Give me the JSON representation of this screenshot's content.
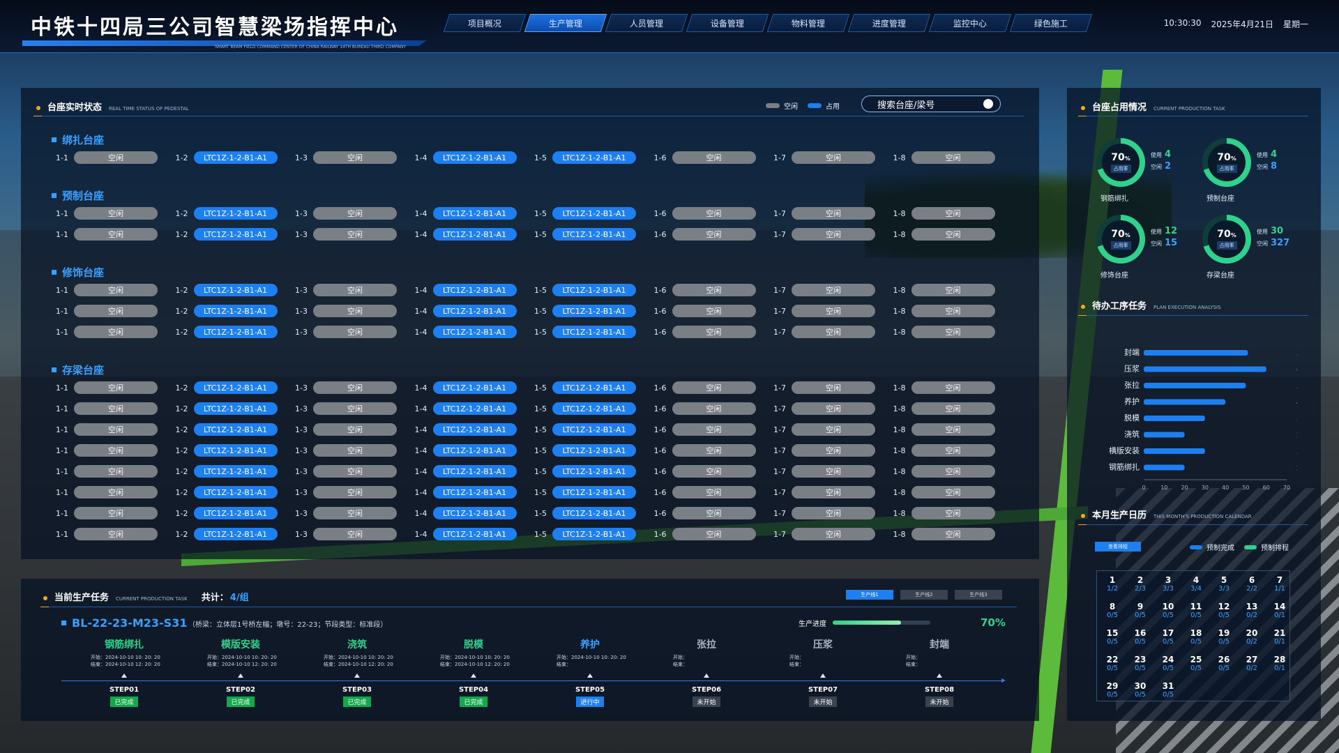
{
  "header": {
    "title": "中铁十四局三公司智慧梁场指挥中心",
    "subtitle": "SMART BEAM FIELD COMMAND CENTER OF CHINA RAILWAY 14TH BUREAU THIRD COMPANY",
    "tabs": [
      "项目概况",
      "生产管理",
      "人员管理",
      "设备管理",
      "物料管理",
      "进度管理",
      "监控中心",
      "绿色施工"
    ],
    "active_tab": "生产管理",
    "time": "10:30:30",
    "date": "2025年4月21日",
    "weekday": "星期一"
  },
  "pedestal": {
    "title": "台座实时状态",
    "title_en": "REAL TIME STATUS OF PEDESTAL",
    "legend_idle": "空闲",
    "legend_used": "占用",
    "search_placeholder": "搜索台座/梁号",
    "idle_label": "空闲",
    "used_label": "LTC1Z-1-2-B1-A1",
    "slot_labels": [
      "1-1",
      "1-2",
      "1-3",
      "1-4",
      "1-5",
      "1-6",
      "1-7",
      "1-8"
    ],
    "sections": [
      {
        "name": "绑扎台座",
        "rows": [
          [
            0,
            1,
            0,
            1,
            1,
            0,
            0,
            0
          ]
        ]
      },
      {
        "name": "预制台座",
        "rows": [
          [
            0,
            1,
            0,
            1,
            1,
            0,
            0,
            0
          ],
          [
            0,
            1,
            0,
            1,
            1,
            0,
            0,
            0
          ]
        ]
      },
      {
        "name": "修饰台座",
        "rows": [
          [
            0,
            1,
            0,
            1,
            1,
            0,
            0,
            0
          ],
          [
            0,
            1,
            0,
            1,
            1,
            0,
            0,
            0
          ],
          [
            0,
            1,
            0,
            1,
            1,
            0,
            0,
            0
          ]
        ]
      },
      {
        "name": "存梁台座",
        "rows": [
          [
            0,
            1,
            0,
            1,
            1,
            0,
            0,
            0
          ],
          [
            0,
            1,
            0,
            1,
            1,
            0,
            0,
            0
          ],
          [
            0,
            1,
            0,
            1,
            1,
            0,
            0,
            0
          ],
          [
            0,
            1,
            0,
            1,
            1,
            0,
            0,
            0
          ],
          [
            0,
            1,
            0,
            1,
            1,
            0,
            0,
            0
          ],
          [
            0,
            1,
            0,
            1,
            1,
            0,
            0,
            0
          ],
          [
            0,
            1,
            0,
            1,
            1,
            0,
            0,
            0
          ],
          [
            0,
            1,
            0,
            1,
            1,
            0,
            0,
            0
          ]
        ]
      }
    ]
  },
  "occupancy": {
    "title": "台座占用情况",
    "title_en": "CURRENT PRODUCTION TASK",
    "pct": "70",
    "pct_unit": "%",
    "caption": "占用率",
    "used_label": "使用",
    "free_label": "空闲",
    "occupancy_rate": 0.7,
    "items": [
      {
        "name": "钢筋绑扎",
        "used": "4",
        "free": "2"
      },
      {
        "name": "预制台座",
        "used": "4",
        "free": "8"
      },
      {
        "name": "修饰台座",
        "used": "12",
        "free": "15"
      },
      {
        "name": "存梁台座",
        "used": "30",
        "free": "327"
      }
    ]
  },
  "pending": {
    "title": "待办工序任务",
    "title_en": "PLAN EXECUTION ANALYSIS"
  },
  "chart_data": {
    "type": "bar",
    "orientation": "horizontal",
    "categories": [
      "封端",
      "压浆",
      "张拉",
      "养护",
      "脱模",
      "浇筑",
      "横版安装",
      "钢筋绑扎"
    ],
    "values": [
      51,
      60,
      50,
      40,
      30,
      20,
      30,
      20
    ],
    "xlim": [
      0,
      70
    ],
    "xticks": [
      0,
      10,
      20,
      30,
      40,
      50,
      60,
      70
    ],
    "bar_color": "#1e7ff0"
  },
  "calendar": {
    "title": "本月生产日历",
    "title_en": "THIS MONTH'S PRODUCTION CALENDAR",
    "tab": "查看排程",
    "legend_done": "预制完成",
    "legend_plan": "预制排程",
    "color_done": "#1e7ff0",
    "color_plan": "#2fd28c",
    "days": [
      [
        "1",
        "1/2"
      ],
      [
        "2",
        "2/3"
      ],
      [
        "3",
        "3/3"
      ],
      [
        "4",
        "3/4"
      ],
      [
        "5",
        "3/3"
      ],
      [
        "6",
        "2/2"
      ],
      [
        "7",
        "1/1"
      ],
      [
        "8",
        "0/5"
      ],
      [
        "9",
        "0/5"
      ],
      [
        "10",
        "0/5"
      ],
      [
        "11",
        "0/5"
      ],
      [
        "12",
        "0/5"
      ],
      [
        "13",
        "0/2"
      ],
      [
        "14",
        "0/1"
      ],
      [
        "15",
        "0/5"
      ],
      [
        "16",
        "0/5"
      ],
      [
        "17",
        "0/5"
      ],
      [
        "18",
        "0/5"
      ],
      [
        "19",
        "0/5"
      ],
      [
        "20",
        "0/2"
      ],
      [
        "21",
        "0/1"
      ],
      [
        "22",
        "0/5"
      ],
      [
        "23",
        "0/5"
      ],
      [
        "24",
        "0/5"
      ],
      [
        "25",
        "0/5"
      ],
      [
        "26",
        "0/5"
      ],
      [
        "27",
        "0/2"
      ],
      [
        "28",
        "0/1"
      ],
      [
        "29",
        "0/5"
      ],
      [
        "30",
        "0/5"
      ],
      [
        "31",
        "0/5"
      ]
    ]
  },
  "task": {
    "title": "当前生产任务",
    "title_en": "CURRENT PRODUCTION TASK",
    "total_label": "共计：",
    "total": "4/组",
    "line_tabs": [
      "生产线1",
      "生产线2",
      "生产线3"
    ],
    "beam_id": "BL-22-23-M23-S31",
    "info": "（桥梁：立体层1号桥左幅；墩号：22-23；节段类型：标准段）",
    "progress_label": "生产进度",
    "progress": 0.7,
    "progress_text": "70%",
    "steps": [
      {
        "name": "钢筋绑扎",
        "start": "开始：2024-10-10 10: 20: 20",
        "end": "结束：2024-10-10 12: 20: 20",
        "code": "STEP01",
        "status": "已完成",
        "state": "done"
      },
      {
        "name": "模版安装",
        "start": "开始：2024-10-10 10: 20: 20",
        "end": "结束：2024-10-10 12: 20: 20",
        "code": "STEP02",
        "status": "已完成",
        "state": "done"
      },
      {
        "name": "浇筑",
        "start": "开始：2024-10-10 10: 20: 20",
        "end": "结束：2024-10-10 12: 20: 20",
        "code": "STEP03",
        "status": "已完成",
        "state": "done"
      },
      {
        "name": "脱模",
        "start": "开始：2024-10-10 10: 20: 20",
        "end": "结束：2024-10-10 12: 20: 20",
        "code": "STEP04",
        "status": "已完成",
        "state": "done"
      },
      {
        "name": "养护",
        "start": "开始：2024-10-10 10: 20: 20",
        "end": "结束：",
        "code": "STEP05",
        "status": "进行中",
        "state": "doing"
      },
      {
        "name": "张拉",
        "start": "开始：",
        "end": "结束：",
        "code": "STEP06",
        "status": "未开始",
        "state": "todo"
      },
      {
        "name": "压浆",
        "start": "开始：",
        "end": "结束：",
        "code": "STEP07",
        "status": "未开始",
        "state": "todo"
      },
      {
        "name": "封端",
        "start": "开始：",
        "end": "结束：",
        "code": "STEP08",
        "status": "未开始",
        "state": "todo"
      }
    ]
  },
  "colors": {
    "accent": "#1e7ff0",
    "done": "#12a84c",
    "doing": "#1e7ff0",
    "todo": "#3a4250",
    "green": "#2fd28c",
    "orange": "#f0a825",
    "idle": "#7a7f86"
  }
}
